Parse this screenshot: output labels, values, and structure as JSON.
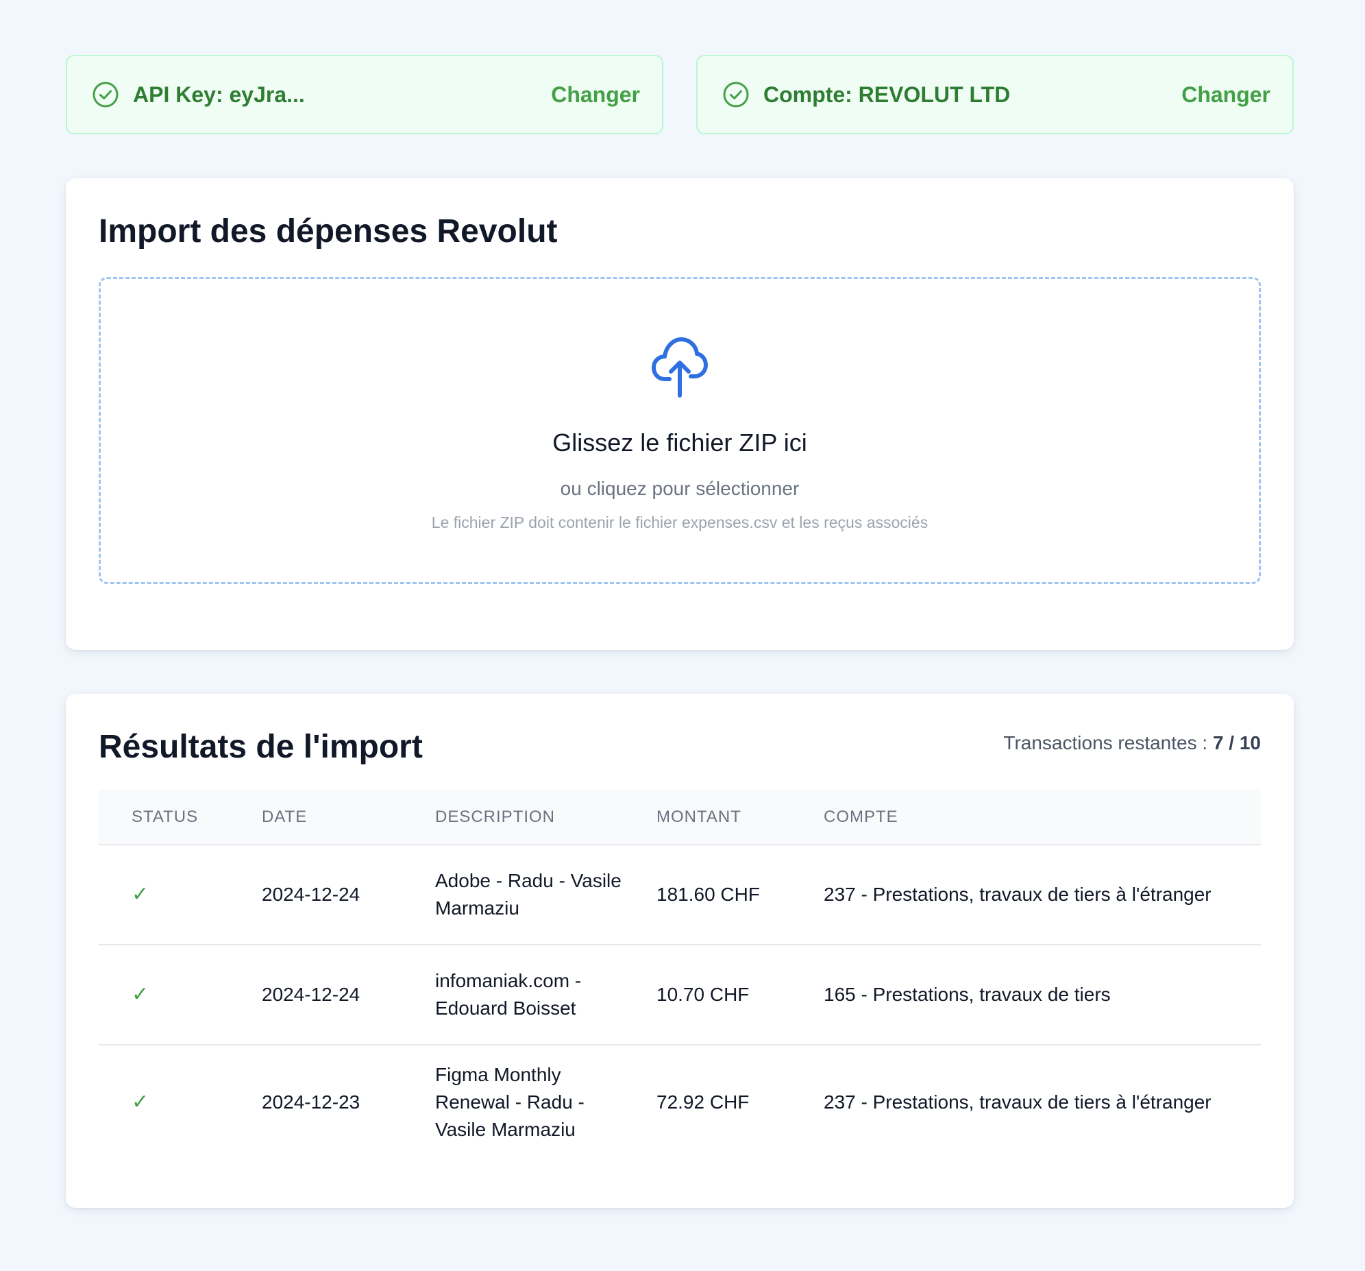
{
  "status": {
    "api": {
      "label": "API Key: eyJra...",
      "action": "Changer"
    },
    "account": {
      "label": "Compte: REVOLUT LTD",
      "action": "Changer"
    }
  },
  "import": {
    "title": "Import des dépenses Revolut",
    "dropzone": {
      "title": "Glissez le fichier ZIP ici",
      "subtitle": "ou cliquez pour sélectionner",
      "hint": "Le fichier ZIP doit contenir le fichier expenses.csv et les reçus associés"
    }
  },
  "results": {
    "title": "Résultats de l'import",
    "remaining_label": "Transactions restantes :",
    "remaining_value": "7 / 10",
    "columns": [
      "STATUS",
      "DATE",
      "DESCRIPTION",
      "MONTANT",
      "COMPTE"
    ],
    "rows": [
      {
        "status": "✓",
        "date": "2024-12-24",
        "description": "Adobe - Radu - Vasile Marmaziu",
        "amount": "181.60 CHF",
        "account": "237 - Prestations, travaux de tiers à l'étranger"
      },
      {
        "status": "✓",
        "date": "2024-12-24",
        "description": "infomaniak.com - Edouard Boisset",
        "amount": "10.70 CHF",
        "account": "165 - Prestations, travaux de tiers"
      },
      {
        "status": "✓",
        "date": "2024-12-23",
        "description": "Figma Monthly Renewal - Radu - Vasile Marmaziu",
        "amount": "72.92 CHF",
        "account": "237 - Prestations, travaux de tiers à l'étranger"
      }
    ]
  },
  "colors": {
    "success": "#43a047",
    "accent": "#2f6fe0",
    "background": "#f2f7fe"
  }
}
